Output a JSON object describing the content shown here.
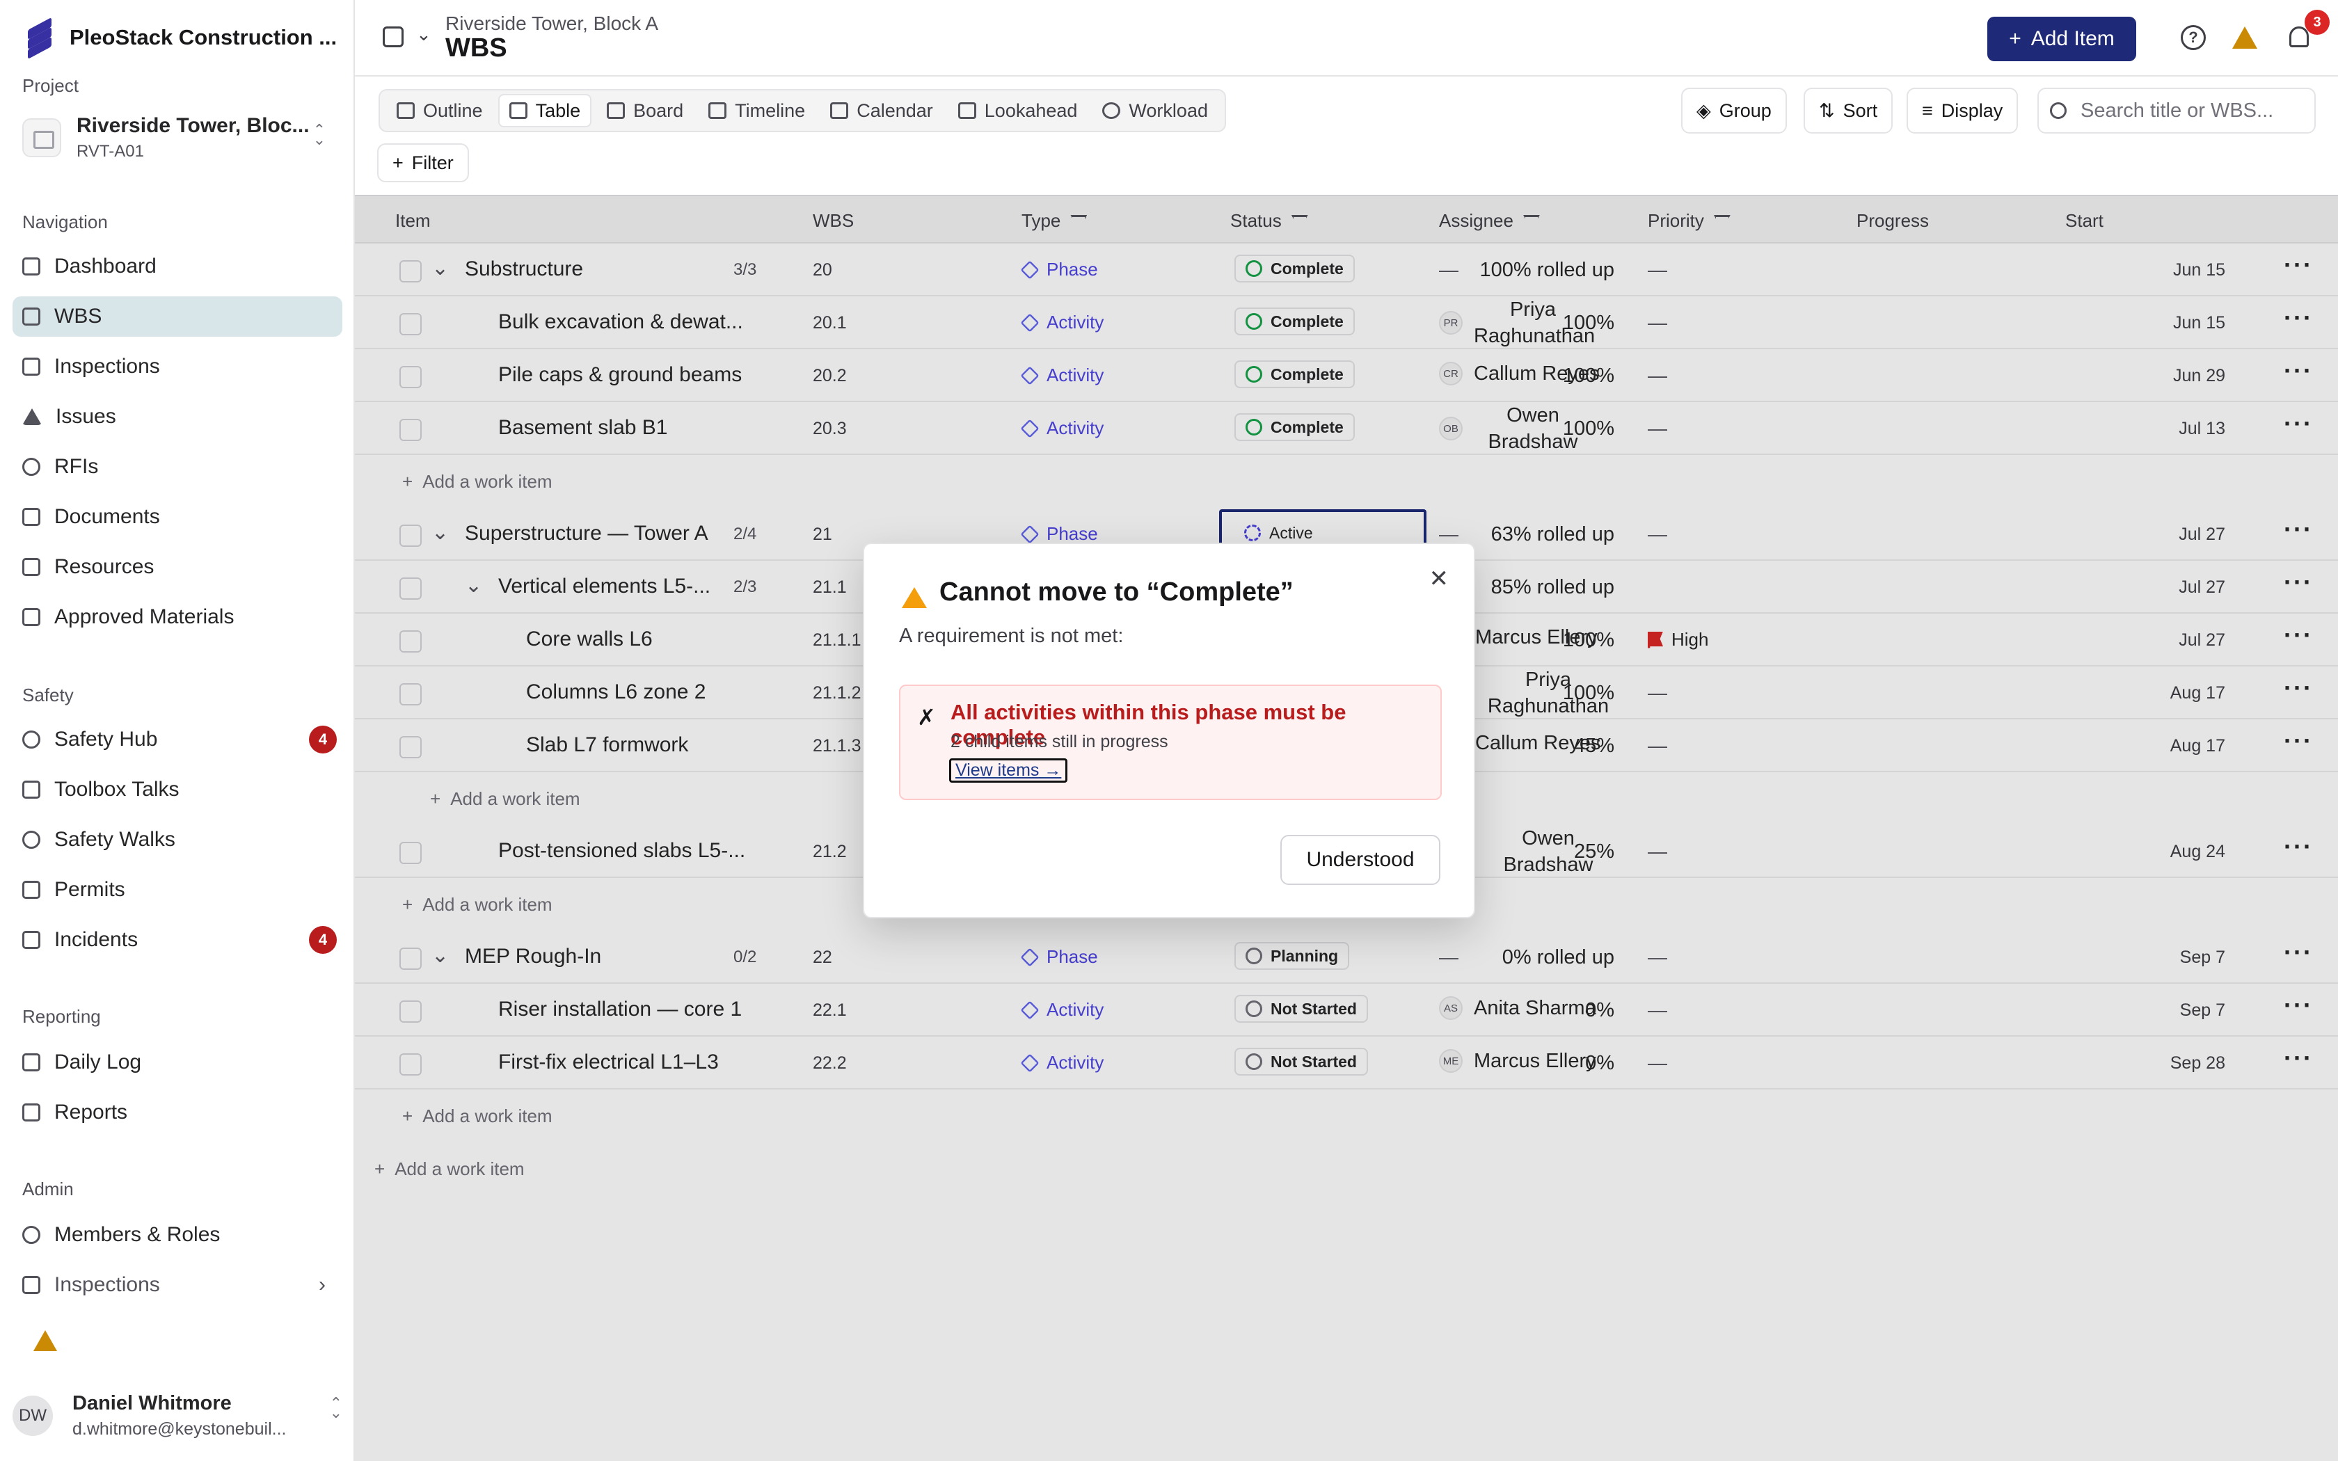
{
  "app": {
    "name": "PleoStack Construction ..."
  },
  "sidebar": {
    "project_section": "Project",
    "project": {
      "name": "Riverside Tower, Bloc...",
      "code": "RVT-A01"
    },
    "navigation_section": "Navigation",
    "nav": [
      {
        "label": "Dashboard"
      },
      {
        "label": "WBS"
      },
      {
        "label": "Inspections"
      },
      {
        "label": "Issues"
      },
      {
        "label": "RFIs"
      },
      {
        "label": "Documents"
      },
      {
        "label": "Resources"
      },
      {
        "label": "Approved Materials"
      }
    ],
    "safety_section": "Safety",
    "safety": [
      {
        "label": "Safety Hub",
        "badge": "4"
      },
      {
        "label": "Toolbox Talks"
      },
      {
        "label": "Safety Walks"
      },
      {
        "label": "Permits"
      },
      {
        "label": "Incidents",
        "badge": "4"
      }
    ],
    "reporting_section": "Reporting",
    "reporting": [
      {
        "label": "Daily Log"
      },
      {
        "label": "Reports"
      }
    ],
    "admin_section": "Admin",
    "admin": [
      {
        "label": "Members & Roles"
      },
      {
        "label": "Inspections"
      }
    ],
    "user": {
      "initials": "DW",
      "name": "Daniel Whitmore",
      "email": "d.whitmore@keystonebuil..."
    }
  },
  "header": {
    "breadcrumb": "Riverside Tower, Block A",
    "title": "WBS",
    "add_label": "Add Item",
    "notifications": "3"
  },
  "views": [
    {
      "label": "Outline"
    },
    {
      "label": "Table"
    },
    {
      "label": "Board"
    },
    {
      "label": "Timeline"
    },
    {
      "label": "Calendar"
    },
    {
      "label": "Lookahead"
    },
    {
      "label": "Workload"
    }
  ],
  "toolbar": {
    "group": "Group",
    "sort": "Sort",
    "display": "Display",
    "search_placeholder": "Search title or WBS...",
    "filter": "Filter"
  },
  "columns": {
    "item": "Item",
    "wbs": "WBS",
    "type": "Type",
    "status": "Status",
    "assignee": "Assignee",
    "priority": "Priority",
    "progress": "Progress",
    "start": "Start"
  },
  "rows": [
    {
      "name": "Substructure",
      "count": "3/3",
      "wbs": "20",
      "type": "Phase",
      "status": "Complete",
      "assignee": "—",
      "priority": "—",
      "progress": "100% rolled up",
      "start": "Jun 15"
    },
    {
      "name": "Bulk excavation & dewat...",
      "wbs": "20.1",
      "type": "Activity",
      "status": "Complete",
      "initials": "PR",
      "assignee": "Priya Raghunathan",
      "priority": "—",
      "progress": "100%",
      "start": "Jun 15"
    },
    {
      "name": "Pile caps & ground beams",
      "wbs": "20.2",
      "type": "Activity",
      "status": "Complete",
      "initials": "CR",
      "assignee": "Callum Reyes",
      "priority": "—",
      "progress": "100%",
      "start": "Jun 29"
    },
    {
      "name": "Basement slab B1",
      "wbs": "20.3",
      "type": "Activity",
      "status": "Complete",
      "initials": "OB",
      "assignee": "Owen Bradshaw",
      "priority": "—",
      "progress": "100%",
      "start": "Jul 13"
    },
    {
      "name": "Superstructure — Tower A",
      "count": "2/4",
      "wbs": "21",
      "type": "Phase",
      "status": "Active",
      "assignee": "—",
      "priority": "—",
      "progress": "63% rolled up",
      "start": "Jul 27"
    },
    {
      "name": "Vertical elements L5-...",
      "count": "2/3",
      "wbs": "21.1",
      "progress": "85% rolled up",
      "start": "Jul 27"
    },
    {
      "name": "Core walls L6",
      "wbs": "21.1.1",
      "assignee": "Marcus Ellery",
      "priority": "High",
      "progress": "100%",
      "start": "Jul 27"
    },
    {
      "name": "Columns L6 zone 2",
      "wbs": "21.1.2",
      "assignee": "Priya Raghunathan",
      "priority": "—",
      "progress": "100%",
      "start": "Aug 17"
    },
    {
      "name": "Slab L7 formwork",
      "wbs": "21.1.3",
      "assignee": "Callum Reyes",
      "priority": "—",
      "progress": "45%",
      "start": "Aug 17"
    },
    {
      "name": "Post-tensioned slabs L5-...",
      "wbs": "21.2",
      "assignee": "Owen Bradshaw",
      "priority": "—",
      "progress": "25%",
      "start": "Aug 24"
    },
    {
      "name": "MEP Rough-In",
      "count": "0/2",
      "wbs": "22",
      "type": "Phase",
      "status": "Planning",
      "assignee": "—",
      "priority": "—",
      "progress": "0% rolled up",
      "start": "Sep 7"
    },
    {
      "name": "Riser installation — core 1",
      "wbs": "22.1",
      "type": "Activity",
      "status": "Not Started",
      "initials": "AS",
      "assignee": "Anita Sharma",
      "priority": "—",
      "progress": "0%",
      "start": "Sep 7"
    },
    {
      "name": "First-fix electrical L1–L3",
      "wbs": "22.2",
      "type": "Activity",
      "status": "Not Started",
      "initials": "ME",
      "assignee": "Marcus Ellery",
      "priority": "—",
      "progress": "0%",
      "start": "Sep 28"
    }
  ],
  "add_work_item": "Add a work item",
  "modal": {
    "title": "Cannot move to “Complete”",
    "subtitle": "A requirement is not met:",
    "error_title": "All activities within this phase must be complete",
    "error_detail": "2 child items still in progress",
    "link": "View items →",
    "button": "Understood"
  },
  "colors": {
    "accent": "#1e2a78",
    "danger": "#b91c1c",
    "nav_active": "#d8e6ea",
    "type": "#4f46e5"
  }
}
